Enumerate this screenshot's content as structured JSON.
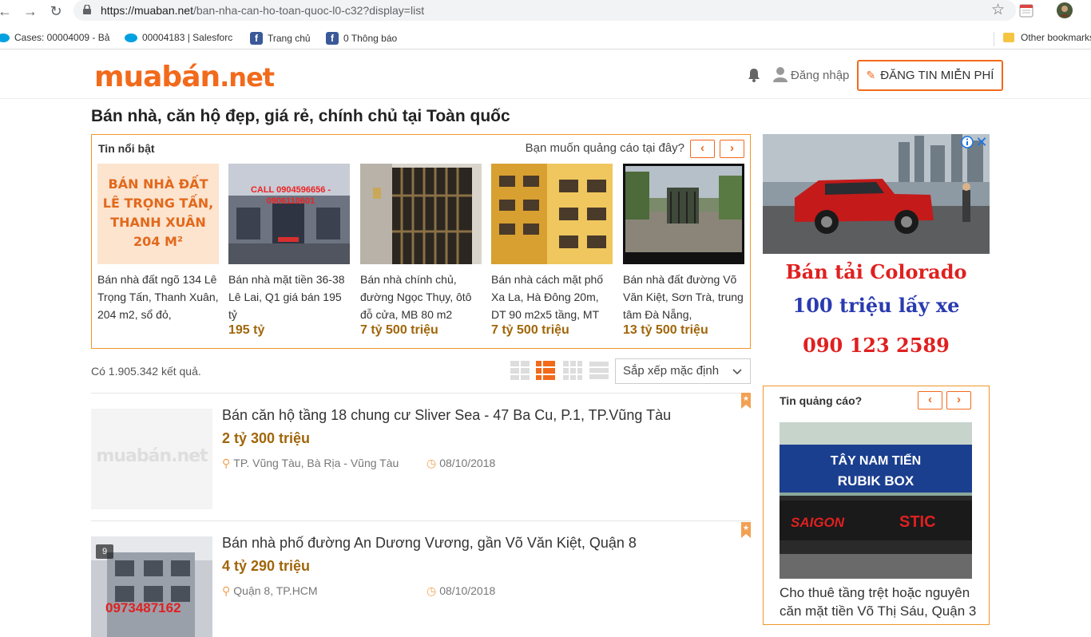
{
  "browser": {
    "url_host": "https://muaban.net",
    "url_path": "/ban-nha-can-ho-toan-quoc-l0-c32?display=list",
    "bookmarks": [
      {
        "label": "Cases: 00004009 - Bả"
      },
      {
        "label": "00004183 | Salesforc"
      },
      {
        "label": "Trang chủ"
      },
      {
        "label": "0 Thông báo"
      }
    ],
    "other_bookmarks": "Other bookmarks"
  },
  "header": {
    "logo_main": "muabán",
    "logo_suffix": ".net",
    "login_label": "Đăng nhập",
    "post_button_label": "ĐĂNG TIN MIỄN PHÍ"
  },
  "page": {
    "title": "Bán nhà, căn hộ đẹp, giá rẻ, chính chủ tại Toàn quốc"
  },
  "featured": {
    "title": "Tin nổi bật",
    "ad_question": "Bạn muốn quảng cáo tại đây?",
    "prev_label": "‹",
    "next_label": "›",
    "items": [
      {
        "image_caption": "BÁN NHÀ ĐẤT\nLÊ TRỌNG TẤN,\nTHANH XUÂN\n204 M²",
        "text": "Bán nhà đất ngõ 134 Lê Trọng Tấn, Thanh Xuân, 204 m2, sổ đỏ,",
        "price": ""
      },
      {
        "image_caption": "CALL 0904596656 - 0906110601",
        "text": "Bán nhà mặt tiền 36-38 Lê Lai, Q1 giá bán 195 tỷ",
        "price": "195 tỷ"
      },
      {
        "image_caption": "",
        "text": "Bán nhà chính chủ, đường Ngọc Thụy, ôtô đỗ cửa, MB 80 m2",
        "price": "7 tỷ 500 triệu"
      },
      {
        "image_caption": "",
        "text": "Bán nhà cách mặt phố Xa La, Hà Đông 20m, DT 90 m2x5 tầng, MT",
        "price": "7 tỷ 500 triệu"
      },
      {
        "image_caption": "",
        "text": "Bán nhà đất đường Võ Văn Kiệt, Sơn Trà, trung tâm Đà Nẵng,",
        "price": "13 tỷ 500 triệu"
      }
    ]
  },
  "results": {
    "count_text": "Có 1.905.342 kết quả.",
    "sort_label": "Sắp xếp mặc định",
    "listings": [
      {
        "title": "Bán căn hộ tầng 18 chung cư Sliver Sea - 47 Ba Cu, P.1, TP.Vũng Tàu",
        "price": "2 tỷ 300 triệu",
        "location": "TP. Vũng Tàu, Bà Rịa - Vũng Tàu",
        "date": "08/10/2018",
        "thumb_placeholder": "muabán.net"
      },
      {
        "title": "Bán nhà phố đường An Dương Vương, gần Võ Văn Kiệt, Quận 8",
        "price": "4 tỷ 290 triệu",
        "location": "Quận 8, TP.HCM",
        "date": "08/10/2018",
        "photo_count": "9",
        "thumb_caption": "0973487162"
      }
    ]
  },
  "ad_banner": {
    "line1": "Bán tải Colorado",
    "line2": "100 triệu lấy xe",
    "line3": "090 123 2589"
  },
  "side_ads": {
    "title": "Tin quảng cáo?",
    "prev_label": "‹",
    "next_label": "›",
    "sign_line1": "TÂY NAM TIẾN",
    "sign_line2": "RUBIK BOX",
    "sign_line3": "SAIGON",
    "sign_line4": "STIC",
    "text": "Cho thuê tầng trệt hoặc nguyên căn mặt tiền Võ Thị Sáu, Quận 3"
  },
  "colors": {
    "brand": "#f26a1b",
    "price": "#a0660a",
    "ad_red": "#e02020",
    "ad_blue": "#2a3bb0"
  }
}
